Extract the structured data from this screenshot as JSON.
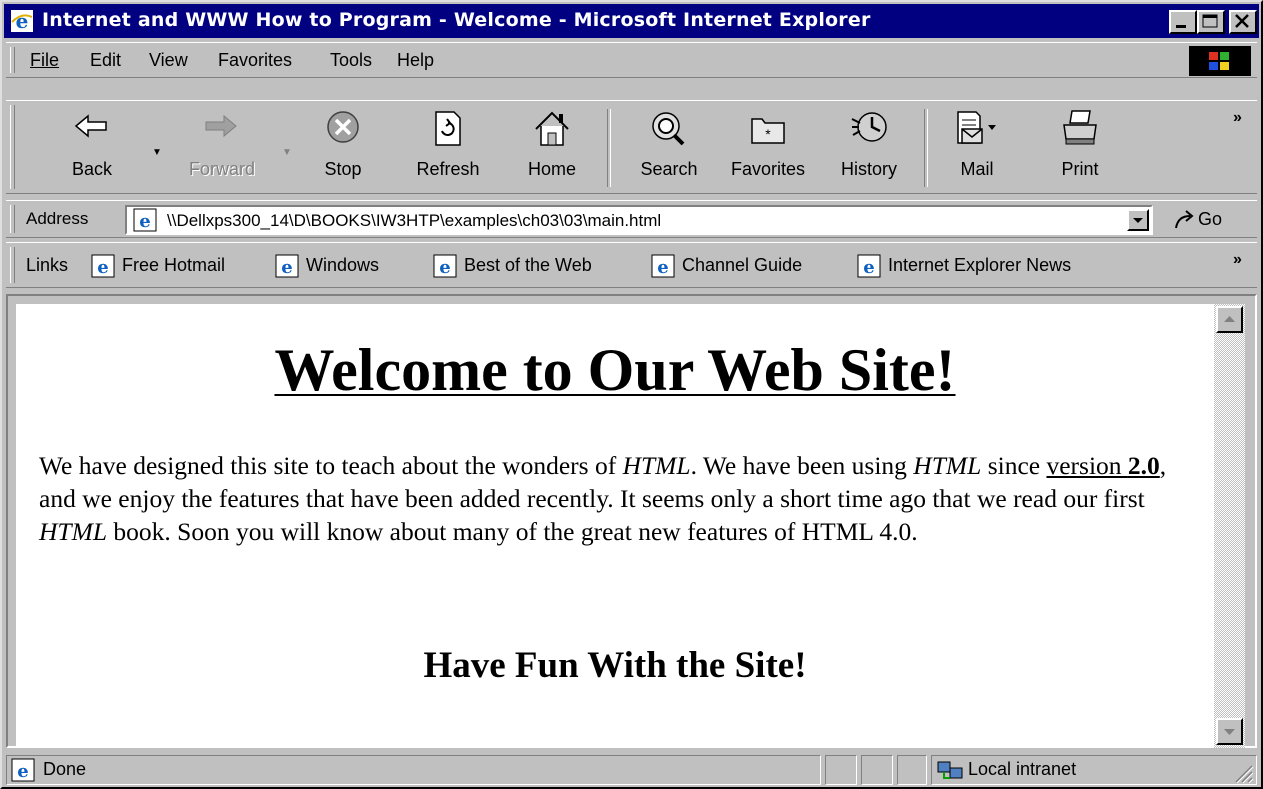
{
  "window": {
    "title": "Internet and WWW How to Program - Welcome - Microsoft Internet Explorer",
    "controls": [
      "minimize",
      "maximize",
      "close"
    ]
  },
  "menu": {
    "items": [
      {
        "label": "File"
      },
      {
        "label": "Edit"
      },
      {
        "label": "View"
      },
      {
        "label": "Favorites"
      },
      {
        "label": "Tools"
      },
      {
        "label": "Help"
      }
    ]
  },
  "toolbar": {
    "back": "Back",
    "forward": "Forward",
    "stop": "Stop",
    "refresh": "Refresh",
    "home": "Home",
    "search": "Search",
    "favorites": "Favorites",
    "history": "History",
    "mail": "Mail",
    "print": "Print",
    "overflow": "»"
  },
  "address": {
    "label": "Address",
    "value": "\\\\Dellxps300_14\\D\\BOOKS\\IW3HTP\\examples\\ch03\\03\\main.html",
    "go": "Go"
  },
  "links": {
    "label": "Links",
    "items": [
      {
        "label": "Free Hotmail"
      },
      {
        "label": "Windows"
      },
      {
        "label": "Best of the Web"
      },
      {
        "label": "Channel Guide"
      },
      {
        "label": "Internet Explorer News"
      }
    ],
    "overflow": "»"
  },
  "page": {
    "heading": "Welcome to Our Web Site!",
    "paragraph": {
      "t1": "We have designed this site to teach about the wonders of ",
      "html1": "HTML",
      "t2": ". We have been using ",
      "html2": "HTML",
      "t3": " since ",
      "version_word": "version ",
      "version_num": "2.0",
      "t4": ", and we enjoy the features that have been added recently. It seems only a short time ago that we read our first ",
      "html3": "HTML",
      "t5": " book. Soon you will know about many of the great new features of HTML 4.0."
    },
    "subheading": "Have Fun With the Site!"
  },
  "status": {
    "text": "Done",
    "zone": "Local intranet"
  },
  "colors": {
    "titlebar": "#000080",
    "chrome": "#c0c0c0",
    "content_bg": "#ffffff"
  }
}
